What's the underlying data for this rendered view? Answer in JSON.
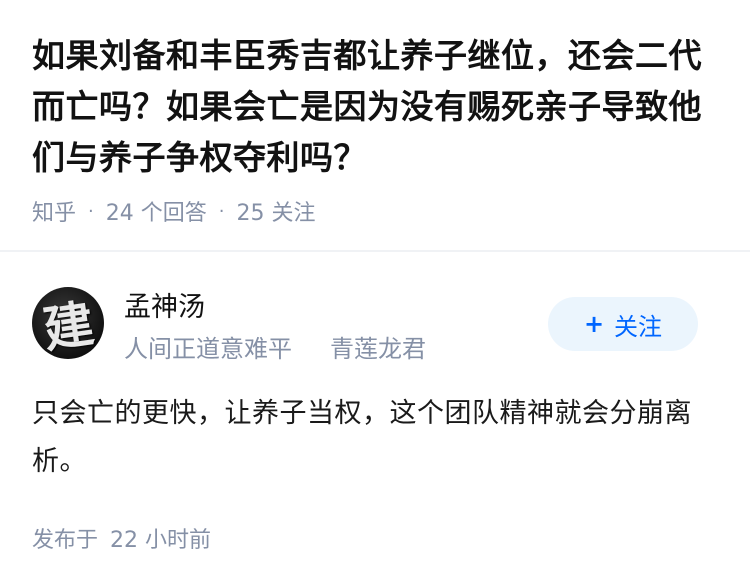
{
  "question": {
    "title": "如果刘备和丰臣秀吉都让养子继位，还会二代而亡吗？如果会亡是因为没有赐死亲子导致他们与养子争权夺利吗？",
    "source": "知乎",
    "answer_count": "24 个回答",
    "follower_count": "25 关注"
  },
  "author": {
    "avatar_char": "建",
    "name": "孟神汤",
    "tags": [
      "人间正道意难平",
      "青莲龙君"
    ],
    "follow_label": "关注",
    "follow_icon": "plus-icon"
  },
  "answer": {
    "content": "只会亡的更快，让养子当权，这个团队精神就会分崩离析。",
    "published_prefix": "发布于",
    "published_time": "22 小时前"
  }
}
